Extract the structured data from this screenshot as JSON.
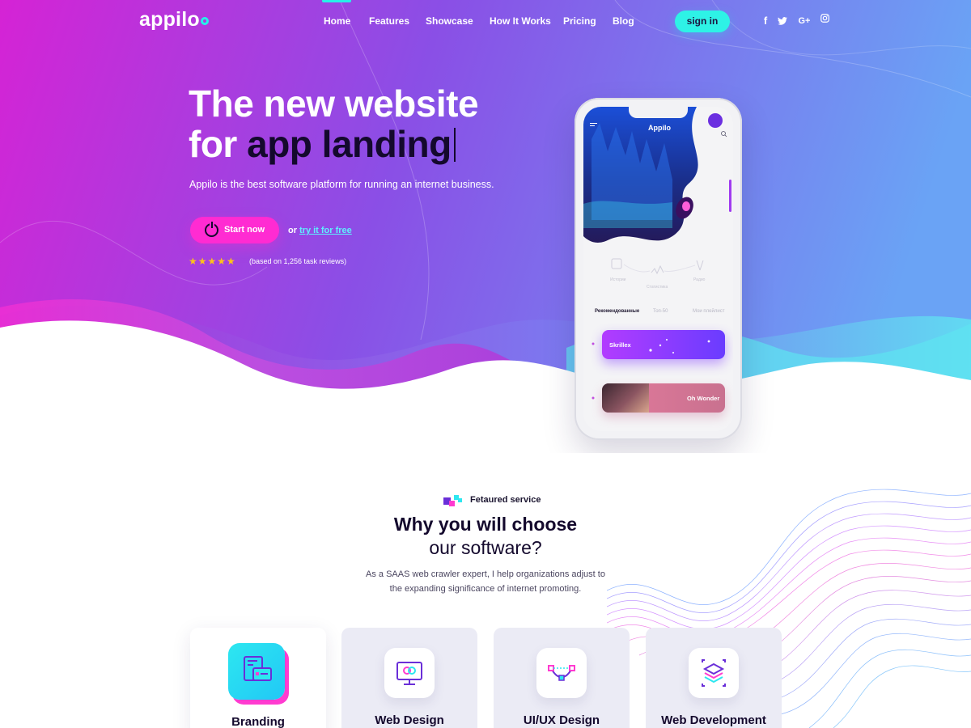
{
  "brand": {
    "name": "appilo",
    "accent": "#27f0e8"
  },
  "nav": {
    "items": [
      {
        "label": "Home",
        "active": true
      },
      {
        "label": "Features"
      },
      {
        "label": "Showcase"
      },
      {
        "label": "How It Works"
      },
      {
        "label": "Pricing"
      },
      {
        "label": "Blog"
      }
    ],
    "signin_label": "sign in",
    "social": [
      {
        "icon": "facebook-icon",
        "glyph": "f"
      },
      {
        "icon": "twitter-icon",
        "glyph": "t"
      },
      {
        "icon": "google-plus-icon",
        "glyph": "G+"
      },
      {
        "icon": "instagram-icon",
        "glyph": ""
      }
    ]
  },
  "hero": {
    "line1": "The new website",
    "line2_prefix": "for ",
    "line2_highlight": "app landing",
    "subtitle": "Appilo is the best software platform for running an internet business.",
    "cta_label": "Start now",
    "or_text": "or",
    "secondary_link": "try it for free",
    "rating": {
      "stars": 5,
      "text": "(based on 1,256 task reviews)"
    },
    "colors": {
      "gradient_start": "#d424d6",
      "gradient_mid": "#7a5cf0",
      "gradient_end": "#72a4f4",
      "cta": "#ff2bd2"
    }
  },
  "phone": {
    "app_title": "Appilo",
    "icon_labels": [
      "Истории",
      "Статистика",
      "Радио"
    ],
    "tabs": [
      {
        "label": "Рекомендованные",
        "active": true
      },
      {
        "label": "Топ-50"
      },
      {
        "label": "Мои плейлист"
      }
    ],
    "cards": [
      {
        "label": "Skrillex"
      },
      {
        "label": "Oh Wonder"
      }
    ]
  },
  "services": {
    "badge_label": "Fetaured service",
    "title_bold": "Why you will choose",
    "title_light": "our software?",
    "description_line1": "As a SAAS web crawler expert, I help organizations adjust to",
    "description_line2": "the expanding significance of internet promoting.",
    "items": [
      {
        "title": "Branding",
        "icon": "branding-icon",
        "highlighted": true
      },
      {
        "title": "Web Design",
        "icon": "monitor-icon"
      },
      {
        "title": "UI/UX Design",
        "icon": "vector-path-icon"
      },
      {
        "title": "Web Development",
        "icon": "layers-icon"
      }
    ]
  }
}
